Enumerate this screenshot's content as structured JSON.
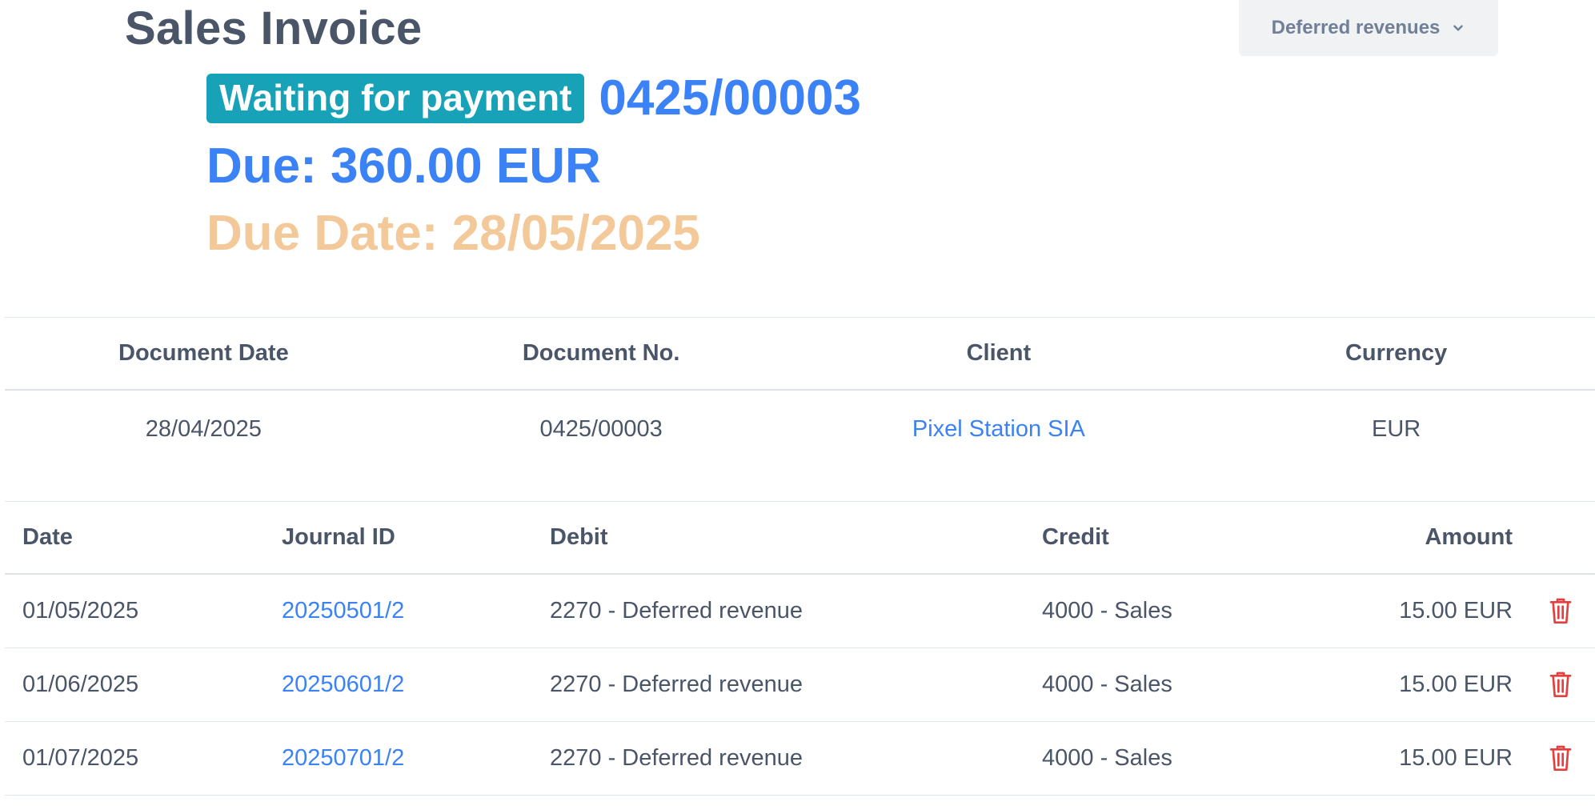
{
  "page": {
    "title": "Sales Invoice",
    "actions_dropdown": "Deferred revenues"
  },
  "invoice": {
    "status": "Waiting for payment",
    "number": "0425/00003",
    "due": "Due: 360.00 EUR",
    "due_date": "Due Date: 28/05/2025"
  },
  "details": {
    "headers": [
      "Document Date",
      "Document No.",
      "Client",
      "Currency"
    ],
    "values": [
      "28/04/2025",
      "0425/00003",
      "Pixel Station SIA",
      "EUR"
    ]
  },
  "table": {
    "headers": {
      "date": "Date",
      "journal_id": "Journal ID",
      "debit": "Debit",
      "credit": "Credit",
      "amount": "Amount"
    },
    "rows": [
      {
        "date": "01/05/2025",
        "journal_id": "20250501/2",
        "debit": "2270 - Deferred revenue",
        "credit": "4000 - Sales",
        "amount": "15.00 EUR"
      },
      {
        "date": "01/06/2025",
        "journal_id": "20250601/2",
        "debit": "2270 - Deferred revenue",
        "credit": "4000 - Sales",
        "amount": "15.00 EUR"
      },
      {
        "date": "01/07/2025",
        "journal_id": "20250701/2",
        "debit": "2270 - Deferred revenue",
        "credit": "4000 - Sales",
        "amount": "15.00 EUR"
      }
    ]
  },
  "icons": {
    "dropdown": "chevron-down-icon",
    "row_action": "trash-icon"
  },
  "colors": {
    "badge": "#17a2b8",
    "link": "#3b82f6",
    "due_date": "#f3c99a",
    "delete": "#e53e3e"
  }
}
